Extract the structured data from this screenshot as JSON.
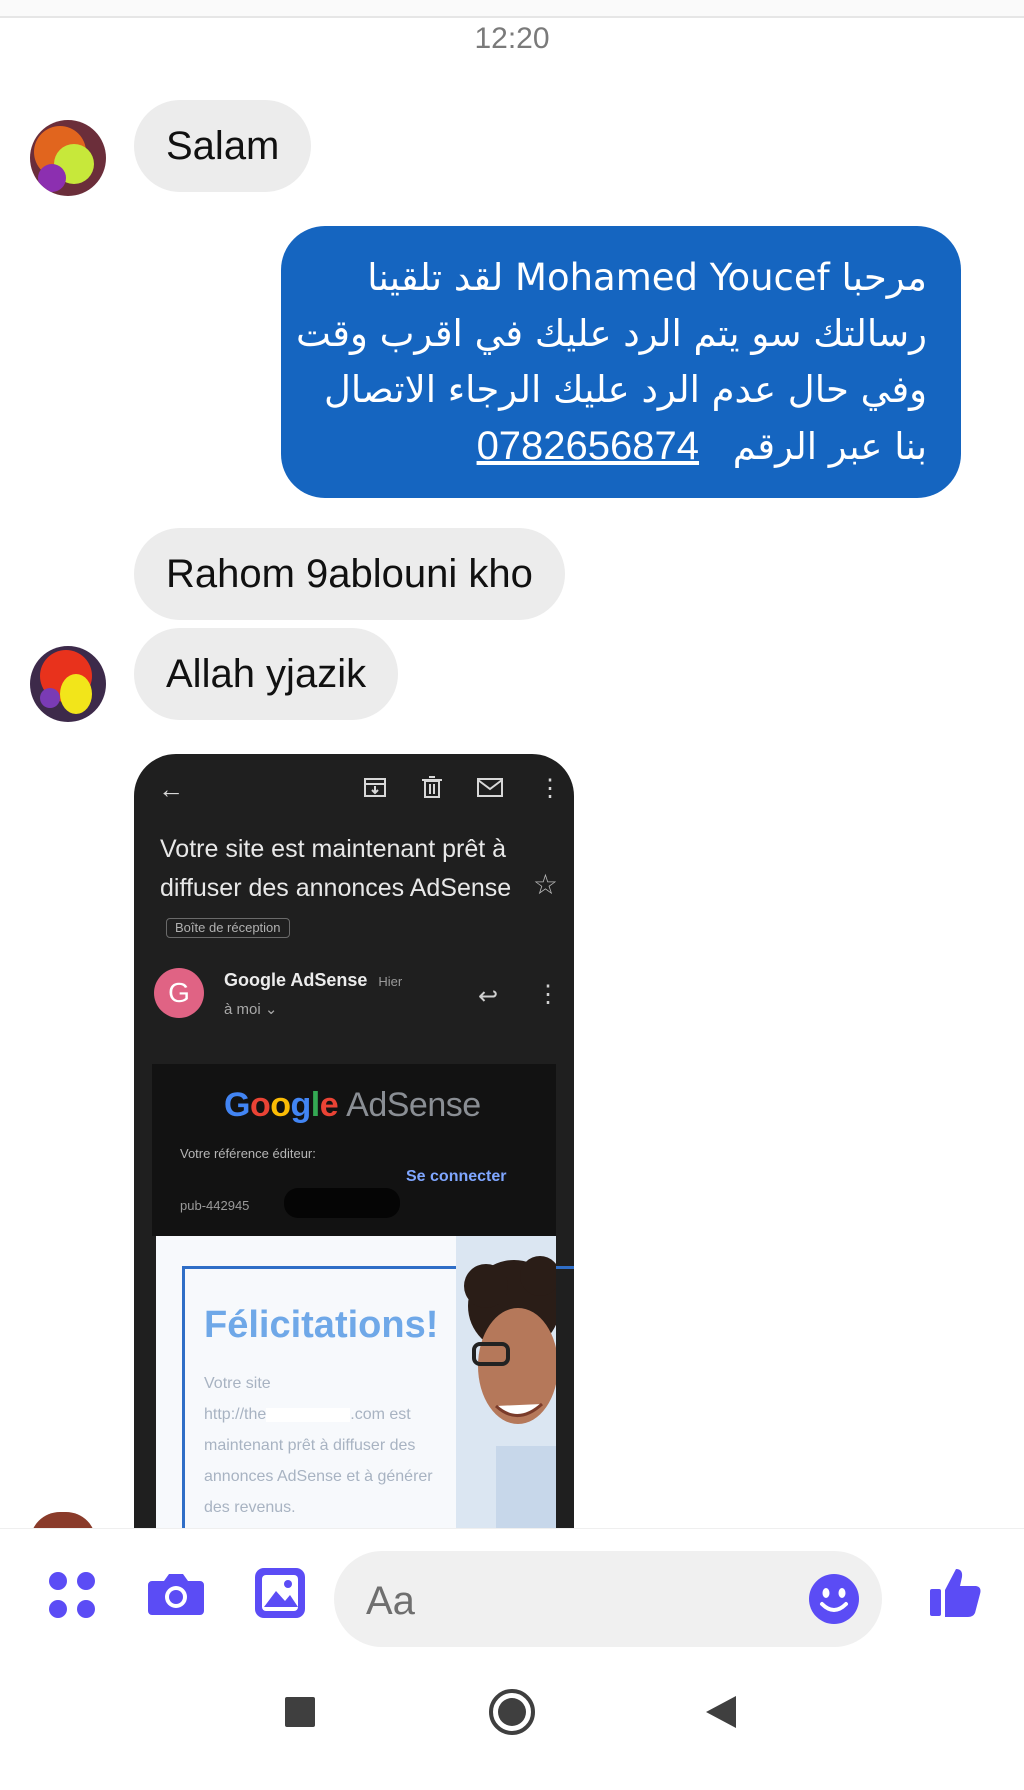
{
  "header": {
    "time": "12:20"
  },
  "messages": {
    "m1": "Salam",
    "reply": {
      "line1": "مرحبا Mohamed Youcef لقد تلقينا",
      "line2": "رسالتك سو يتم الرد عليك في اقرب وقت",
      "line3": "وفي حال عدم الرد عليك الرجاء الاتصال",
      "line4_text": "بنا عبر الرقم",
      "phone": "0782656874"
    },
    "m2": "Rahom 9ablouni kho",
    "m3": "Allah yjazik"
  },
  "screenshot": {
    "subject": "Votre site est maintenant prêt à diffuser des annonces AdSense",
    "label": "Boîte de réception",
    "sender": "Google AdSense",
    "when": "Hier",
    "to": "à moi",
    "avatar_letter": "G",
    "logo_adsense": "AdSense",
    "ref_label": "Votre référence éditeur:",
    "pub_id": "pub-442945",
    "connect": "Se connecter",
    "felicitations": "Félicitations!",
    "body1": "Votre site",
    "body2a": "http://the",
    "body2b": ".com est",
    "body3": "maintenant prêt à diffuser des annonces AdSense et à générer des revenus."
  },
  "composer": {
    "placeholder": "Aa"
  },
  "icons": {
    "apps": "apps-icon",
    "camera": "camera-icon",
    "gallery": "image-icon",
    "emoji": "emoji-icon",
    "like": "thumbs-up-icon",
    "nav_recent": "recent-apps-icon",
    "nav_home": "home-icon",
    "nav_back": "back-icon"
  },
  "colors": {
    "accent": "#5b4cf5",
    "sent_bubble": "#1565c0",
    "received_bubble": "#ececec"
  }
}
